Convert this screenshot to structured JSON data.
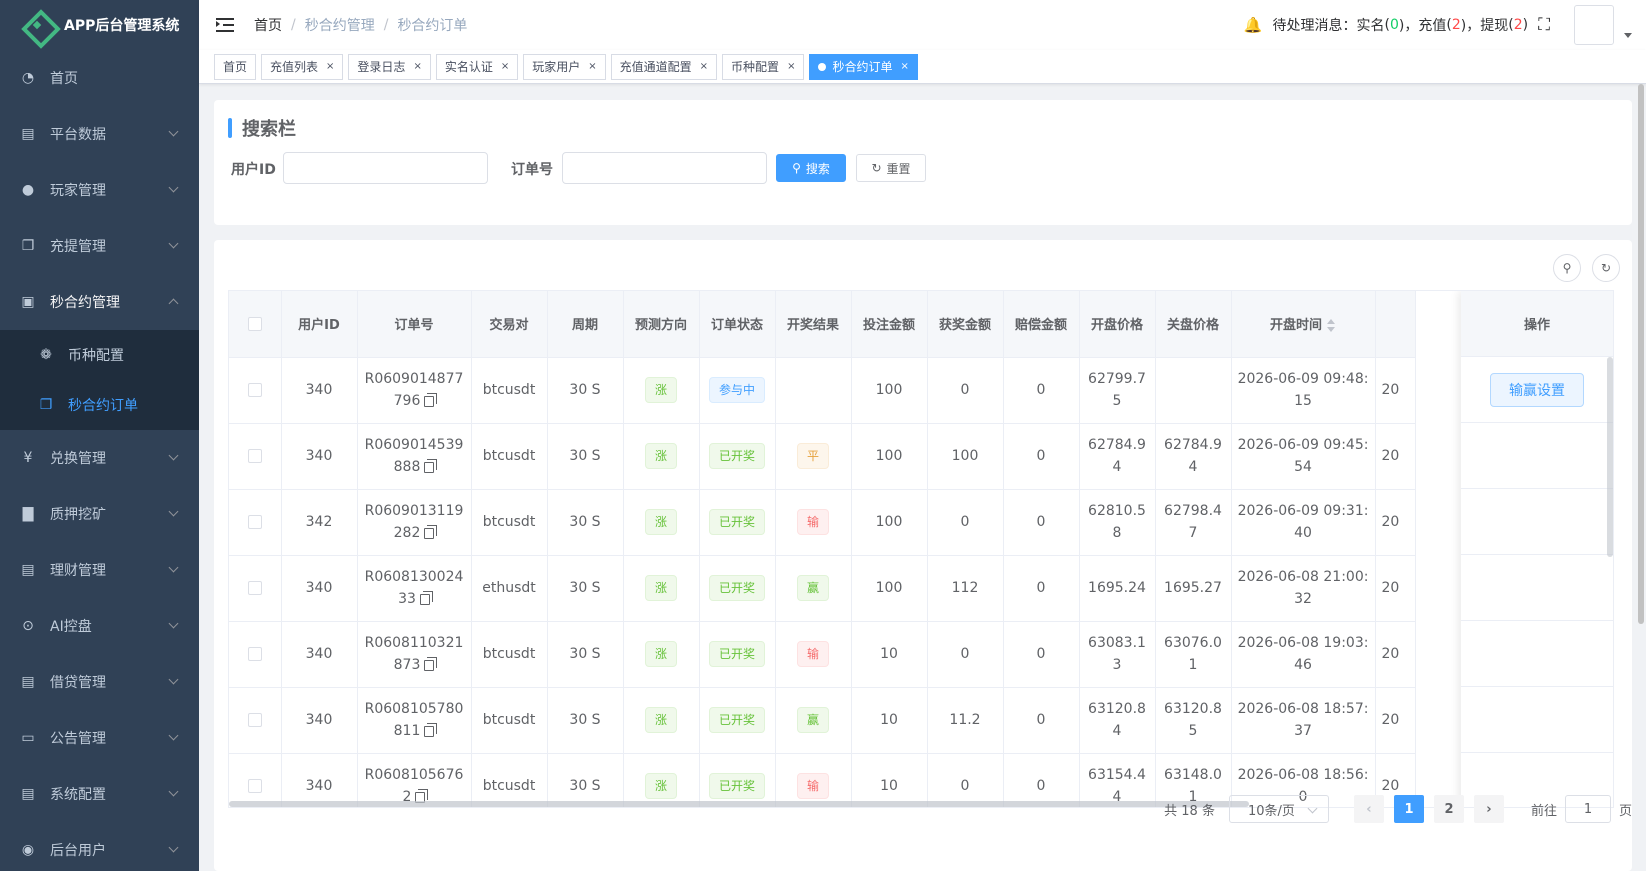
{
  "sidebar": {
    "app_title": "APP后台管理系统",
    "items": [
      {
        "label": "首页",
        "icon": "dashboard-icon"
      },
      {
        "label": "平台数据",
        "icon": "book-icon"
      },
      {
        "label": "玩家管理",
        "icon": "user-icon"
      },
      {
        "label": "充提管理",
        "icon": "copy-icon"
      },
      {
        "label": "秒合约管理",
        "icon": "chart-board-icon"
      },
      {
        "label": "兑换管理",
        "icon": "yen-icon"
      },
      {
        "label": "质押挖矿",
        "icon": "bar-chart-icon"
      },
      {
        "label": "理财管理",
        "icon": "document-icon"
      },
      {
        "label": "AI控盘",
        "icon": "robot-icon"
      },
      {
        "label": "借贷管理",
        "icon": "book-icon"
      },
      {
        "label": "公告管理",
        "icon": "open-book-icon"
      },
      {
        "label": "系统配置",
        "icon": "document-icon"
      },
      {
        "label": "后台用户",
        "icon": "users-icon"
      }
    ],
    "submenu": [
      {
        "label": "币种配置",
        "icon": "coin-icon"
      },
      {
        "label": "秒合约订单",
        "icon": "copy-icon"
      }
    ]
  },
  "navbar": {
    "breadcrumb": [
      "首页",
      "秒合约管理",
      "秒合约订单"
    ],
    "notice_label": "待处理消息：",
    "notice_items": [
      {
        "name": "实名",
        "count": "0",
        "color": "green"
      },
      {
        "name": "充值",
        "count": "2",
        "color": "red"
      },
      {
        "name": "提现",
        "count": "2",
        "color": "red"
      }
    ]
  },
  "tags": [
    {
      "label": "首页",
      "closable": false,
      "active": false
    },
    {
      "label": "充值列表",
      "closable": true,
      "active": false
    },
    {
      "label": "登录日志",
      "closable": true,
      "active": false
    },
    {
      "label": "实名认证",
      "closable": true,
      "active": false
    },
    {
      "label": "玩家用户",
      "closable": true,
      "active": false
    },
    {
      "label": "充值通道配置",
      "closable": true,
      "active": false
    },
    {
      "label": "币种配置",
      "closable": true,
      "active": false
    },
    {
      "label": "秒合约订单",
      "closable": true,
      "active": true
    }
  ],
  "search": {
    "title": "搜索栏",
    "user_id_label": "用户ID",
    "user_id_value": "",
    "order_no_label": "订单号",
    "order_no_value": "",
    "search_button": "搜索",
    "reset_button": "重置"
  },
  "table": {
    "columns": [
      "用户ID",
      "订单号",
      "交易对",
      "周期",
      "预测方向",
      "订单状态",
      "开奖结果",
      "投注金额",
      "获奖金额",
      "赔偿金额",
      "开盘价格",
      "关盘价格",
      "开盘时间"
    ],
    "action_column": "操作",
    "action_button": "输赢设置",
    "rows": [
      {
        "user_id": "340",
        "order_no": "R0609014877796",
        "pair": "btcusdt",
        "period": "30 S",
        "direction": "涨",
        "status": "参与中",
        "status_type": "primary",
        "result": "",
        "result_type": "",
        "bet": "100",
        "win": "0",
        "comp": "0",
        "open_price": "62799.75",
        "close_price": "",
        "open_time": "2026-06-09 09:48:15",
        "extra": "20"
      },
      {
        "user_id": "340",
        "order_no": "R0609014539888",
        "pair": "btcusdt",
        "period": "30 S",
        "direction": "涨",
        "status": "已开奖",
        "status_type": "success",
        "result": "平",
        "result_type": "warning",
        "bet": "100",
        "win": "100",
        "comp": "0",
        "open_price": "62784.94",
        "close_price": "62784.94",
        "open_time": "2026-06-09 09:45:54",
        "extra": "20"
      },
      {
        "user_id": "342",
        "order_no": "R0609013119282",
        "pair": "btcusdt",
        "period": "30 S",
        "direction": "涨",
        "status": "已开奖",
        "status_type": "success",
        "result": "输",
        "result_type": "danger",
        "bet": "100",
        "win": "0",
        "comp": "0",
        "open_price": "62810.58",
        "close_price": "62798.47",
        "open_time": "2026-06-09 09:31:40",
        "extra": "20"
      },
      {
        "user_id": "340",
        "order_no": "R060813002433",
        "pair": "ethusdt",
        "period": "30 S",
        "direction": "涨",
        "status": "已开奖",
        "status_type": "success",
        "result": "赢",
        "result_type": "success",
        "bet": "100",
        "win": "112",
        "comp": "0",
        "open_price": "1695.24",
        "close_price": "1695.27",
        "open_time": "2026-06-08 21:00:32",
        "extra": "20"
      },
      {
        "user_id": "340",
        "order_no": "R0608110321873",
        "pair": "btcusdt",
        "period": "30 S",
        "direction": "涨",
        "status": "已开奖",
        "status_type": "success",
        "result": "输",
        "result_type": "danger",
        "bet": "10",
        "win": "0",
        "comp": "0",
        "open_price": "63083.13",
        "close_price": "63076.01",
        "open_time": "2026-06-08 19:03:46",
        "extra": "20"
      },
      {
        "user_id": "340",
        "order_no": "R0608105780811",
        "pair": "btcusdt",
        "period": "30 S",
        "direction": "涨",
        "status": "已开奖",
        "status_type": "success",
        "result": "赢",
        "result_type": "success",
        "bet": "10",
        "win": "11.2",
        "comp": "0",
        "open_price": "63120.84",
        "close_price": "63120.85",
        "open_time": "2026-06-08 18:57:37",
        "extra": "20"
      },
      {
        "user_id": "340",
        "order_no": "R06081056762",
        "pair": "btcusdt",
        "period": "30 S",
        "direction": "涨",
        "status": "已开奖",
        "status_type": "success",
        "result": "输",
        "result_type": "danger",
        "bet": "10",
        "win": "0",
        "comp": "0",
        "open_price": "63154.44",
        "close_price": "63148.01",
        "open_time": "2026-06-08 18:56:0",
        "extra": "20"
      }
    ]
  },
  "pagination": {
    "total": "共 18 条",
    "page_size": "10条/页",
    "pages": [
      "1",
      "2"
    ],
    "current": "1",
    "goto_label": "前往",
    "goto_value": "1",
    "goto_suffix": "页"
  },
  "colors": {
    "sidebar_bg": "#304156",
    "primary": "#409eff",
    "success": "#67c23a",
    "danger": "#f56c6c",
    "warning": "#e6a23c"
  }
}
